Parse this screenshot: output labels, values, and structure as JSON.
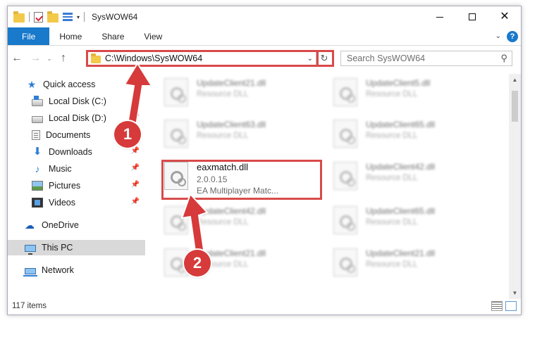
{
  "window": {
    "title": "SysWOW64",
    "qat_dropdown": "▾"
  },
  "controls": {
    "minimize": "",
    "maximize": "",
    "close": "✕"
  },
  "ribbon": {
    "tabs": [
      "File",
      "Home",
      "Share",
      "View"
    ],
    "expand": "⌄",
    "help": "?"
  },
  "nav": {
    "back": "←",
    "forward": "→",
    "recent": "⌄",
    "up": "↑"
  },
  "address": {
    "path": "C:\\Windows\\SysWOW64",
    "dropdown": "⌄",
    "refresh": "↻"
  },
  "search": {
    "placeholder": "Search SysWOW64",
    "icon": "⚲"
  },
  "sidebar": {
    "items": [
      {
        "label": "Quick access",
        "icon": "star-icon",
        "pinned": false
      },
      {
        "label": "Local Disk (C:)",
        "icon": "drive-icon",
        "pinned": true
      },
      {
        "label": "Local Disk (D:)",
        "icon": "drive-icon",
        "pinned": true
      },
      {
        "label": "Documents",
        "icon": "documents-icon",
        "pinned": true
      },
      {
        "label": "Downloads",
        "icon": "download-icon",
        "pinned": true
      },
      {
        "label": "Music",
        "icon": "music-icon",
        "pinned": true
      },
      {
        "label": "Pictures",
        "icon": "pictures-icon",
        "pinned": true
      },
      {
        "label": "Videos",
        "icon": "videos-icon",
        "pinned": true
      },
      {
        "label": "OneDrive",
        "icon": "cloud-icon",
        "pinned": false
      },
      {
        "label": "This PC",
        "icon": "computer-icon",
        "pinned": false,
        "selected": true
      },
      {
        "label": "Network",
        "icon": "network-icon",
        "pinned": false
      }
    ],
    "pin_glyph": "📌"
  },
  "files": [
    {
      "name": "UpdateClient21.dll",
      "type": "Resource DLL"
    },
    {
      "name": "UpdateClient5.dll",
      "type": "Resource DLL"
    },
    {
      "name": "UpdateClient63.dll",
      "type": "Resource DLL"
    },
    {
      "name": "UpdateClient65.dll",
      "type": "Resource DLL"
    },
    {
      "name": "eaxmatch.dll",
      "version": "2.0.0.15",
      "type": "EA Multiplayer Matc..."
    },
    {
      "name": "UpdateClient42.dll",
      "type": "Resource DLL"
    },
    {
      "name": "UpdateClient42.dll",
      "type": "Resource DLL"
    },
    {
      "name": "UpdateClient65.dll",
      "type": "Resource DLL"
    },
    {
      "name": "UpdateClient21.dll",
      "type": "Resource DLL"
    },
    {
      "name": "UpdateClient21.dll",
      "type": "Resource DLL"
    }
  ],
  "status": {
    "item_count": "117 items"
  },
  "annotations": {
    "step1": "1",
    "step2": "2",
    "color": "#d63a3a"
  }
}
